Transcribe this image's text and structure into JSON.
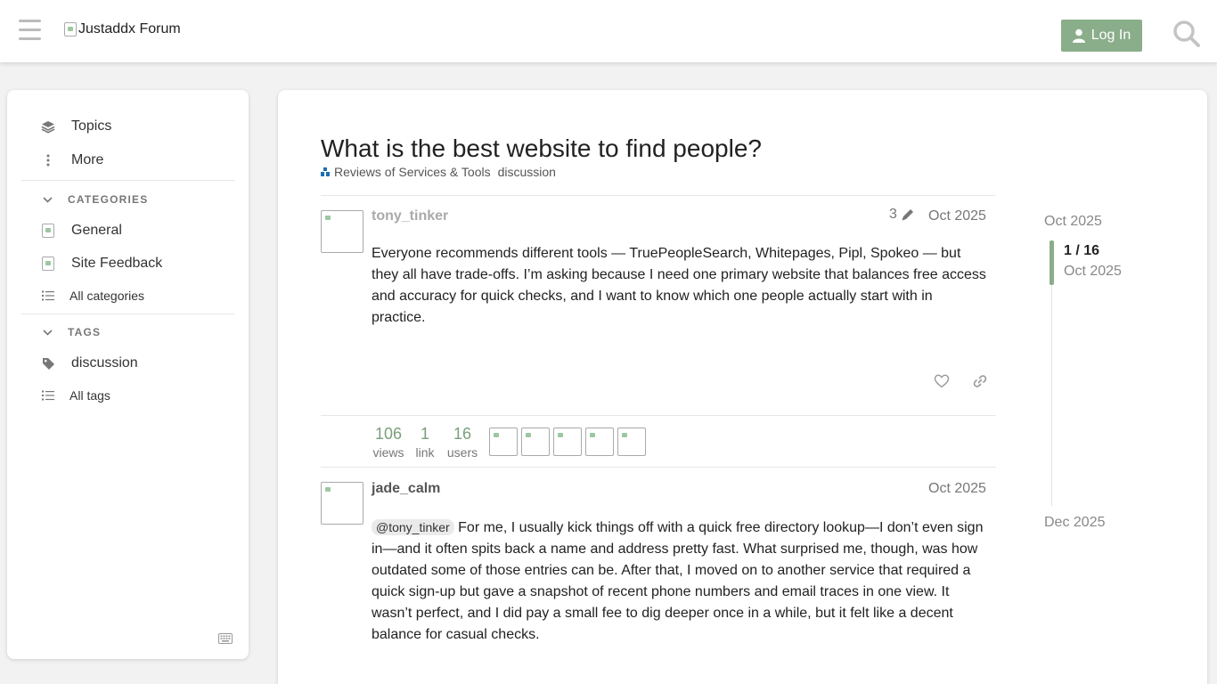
{
  "header": {
    "logo_alt": "Justaddx Forum",
    "login_label": "Log In"
  },
  "sidebar": {
    "nav": [
      {
        "label": "Topics",
        "icon": "layers-icon"
      },
      {
        "label": "More",
        "icon": "vertical-ellipsis-icon"
      }
    ],
    "categories_heading": "CATEGORIES",
    "categories": [
      {
        "label": "General"
      },
      {
        "label": "Site Feedback"
      }
    ],
    "all_categories": "All categories",
    "tags_heading": "TAGS",
    "tags": [
      {
        "label": "discussion"
      }
    ],
    "all_tags": "All tags"
  },
  "topic": {
    "title": "What is the best website to find people?",
    "category": "Reviews of Services & Tools",
    "category_color": "#1a6fb5",
    "tag": "discussion"
  },
  "posts": [
    {
      "username": "tony_tinker",
      "edits": "3",
      "date": "Oct 2025",
      "body": "Everyone recommends different tools — TruePeopleSearch, Whitepages, Pipl, Spokeo — but they all have trade-offs. I’m asking because I need one primary website that balances free access and accuracy for quick checks, and I want to know which one people actually start with in practice."
    },
    {
      "username": "jade_calm",
      "date": "Oct 2025",
      "mention": "@tony_tinker",
      "body": " For me, I usually kick things off with a quick free directory lookup—I don’t even sign in—and it often spits back a name and address pretty fast. What surprised me, though, was how outdated some of those entries can be. After that, I moved on to another service that required a quick sign-up but gave a snapshot of recent phone numbers and email traces in one view. It wasn’t perfect, and I did pay a small fee to dig deeper once in a while, but it felt like a decent balance for casual checks."
    }
  ],
  "topic_map": {
    "views": "106",
    "views_label": "views",
    "links": "1",
    "links_label": "link",
    "users": "16",
    "users_label": "users"
  },
  "timeline": {
    "start_date": "Oct 2025",
    "progress": "1 / 16",
    "current_date": "Oct 2025",
    "end_date": "Dec 2025"
  },
  "colors": {
    "accent": "#8aad8a",
    "stat_number": "#7a9f7a"
  }
}
